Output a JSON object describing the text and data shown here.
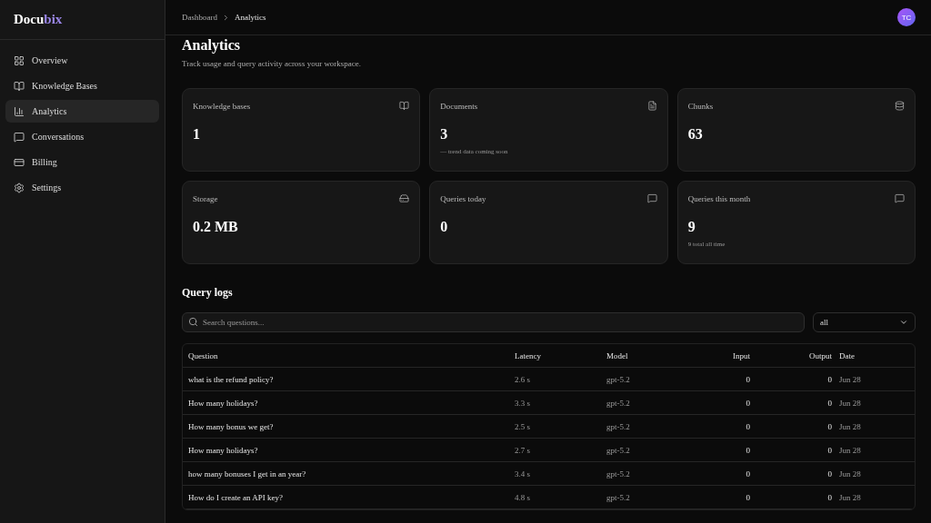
{
  "logo": {
    "text": "Docu",
    "accent": "bix"
  },
  "sidebar": {
    "items": [
      {
        "label": "Overview",
        "selected": false
      },
      {
        "label": "Knowledge Bases",
        "selected": false
      },
      {
        "label": "Analytics",
        "selected": true
      },
      {
        "label": "Conversations",
        "selected": false
      },
      {
        "label": "Billing",
        "selected": false
      },
      {
        "label": "Settings",
        "selected": false
      }
    ]
  },
  "breadcrumb": [
    "Dashboard",
    "Analytics"
  ],
  "avatar": "TC",
  "page": {
    "title": "Analytics",
    "subtitle": "Track usage and query activity across your workspace."
  },
  "stats": [
    {
      "label": "Knowledge bases",
      "value": "1"
    },
    {
      "label": "Documents",
      "value": "3",
      "note": "— trend data coming soon"
    },
    {
      "label": "Chunks",
      "value": "63"
    },
    {
      "label": "Storage",
      "value": "0.2 MB"
    },
    {
      "label": "Queries today",
      "value": "0"
    },
    {
      "label": "Queries this month",
      "value": "9",
      "note": "9 total all time"
    }
  ],
  "query_logs": {
    "title": "Query logs",
    "search": {
      "placeholder": "Search questions..."
    },
    "filter": "all",
    "columns": [
      "Question",
      "Latency",
      "Model",
      "Input",
      "Output",
      "Date"
    ],
    "rows": [
      [
        "what is the refund policy?",
        "2.6 s",
        "gpt-5.2",
        "0",
        "0",
        "Jun 28"
      ],
      [
        "How many holidays?",
        "3.3 s",
        "gpt-5.2",
        "0",
        "0",
        "Jun 28"
      ],
      [
        "How many bonus we get?",
        "2.5 s",
        "gpt-5.2",
        "0",
        "0",
        "Jun 28"
      ],
      [
        "How many holidays?",
        "2.7 s",
        "gpt-5.2",
        "0",
        "0",
        "Jun 28"
      ],
      [
        "how many bonuses I get in an year?",
        "3.4 s",
        "gpt-5.2",
        "0",
        "0",
        "Jun 28"
      ],
      [
        "How do I create an API key?",
        "4.8 s",
        "gpt-5.2",
        "0",
        "0",
        "Jun 28"
      ]
    ]
  }
}
